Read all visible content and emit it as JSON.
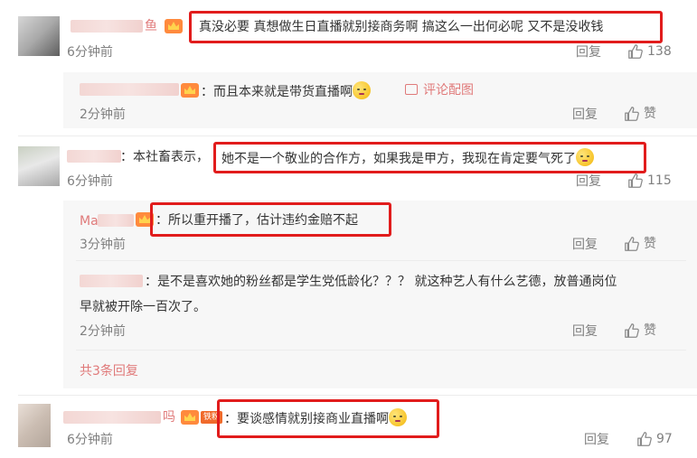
{
  "comments": [
    {
      "name_tail": "鱼",
      "text": "真没必要 真想做生日直播就别接商务啊 搞这么一出何必呢 又不是没收钱",
      "time": "6分钟前",
      "reply_label": "回复",
      "likes": "138"
    },
    {
      "text": "：本社畜表示，",
      "highlight": "她不是一个敬业的合作方，如果我是甲方，我现在肯定要气死了",
      "time": "6分钟前",
      "reply_label": "回复",
      "likes": "115"
    },
    {
      "name_tail": "吗",
      "fan_badge": "铁粉",
      "text": "：要谈感情就别接商业直播啊",
      "time": "6分钟前",
      "reply_label": "回复",
      "likes": "97"
    }
  ],
  "replies": [
    {
      "text": "：而且本来就是带货直播啊",
      "tag": "评论配图",
      "time": "2分钟前",
      "reply_label": "回复",
      "like_label": "赞"
    },
    {
      "name_prefix": "Ma",
      "text": "：所以重开播了，估计违约金赔不起",
      "time": "3分钟前",
      "reply_label": "回复",
      "like_label": "赞"
    },
    {
      "text_line1": "：是不是喜欢她的粉丝都是学生党低龄化？？？ 就这种艺人有什么艺德，放普通岗位",
      "text_line2": "早就被开除一百次了。",
      "time": "2分钟前",
      "reply_label": "回复",
      "like_label": "赞"
    }
  ],
  "more_replies": "共3条回复",
  "colors": {
    "highlight_box": "#e11c1c",
    "link": "#e07a7a",
    "meta": "#808080"
  },
  "icons": [
    "thumb-up-icon",
    "vip-crown-icon",
    "image-icon",
    "emoji-icon"
  ]
}
